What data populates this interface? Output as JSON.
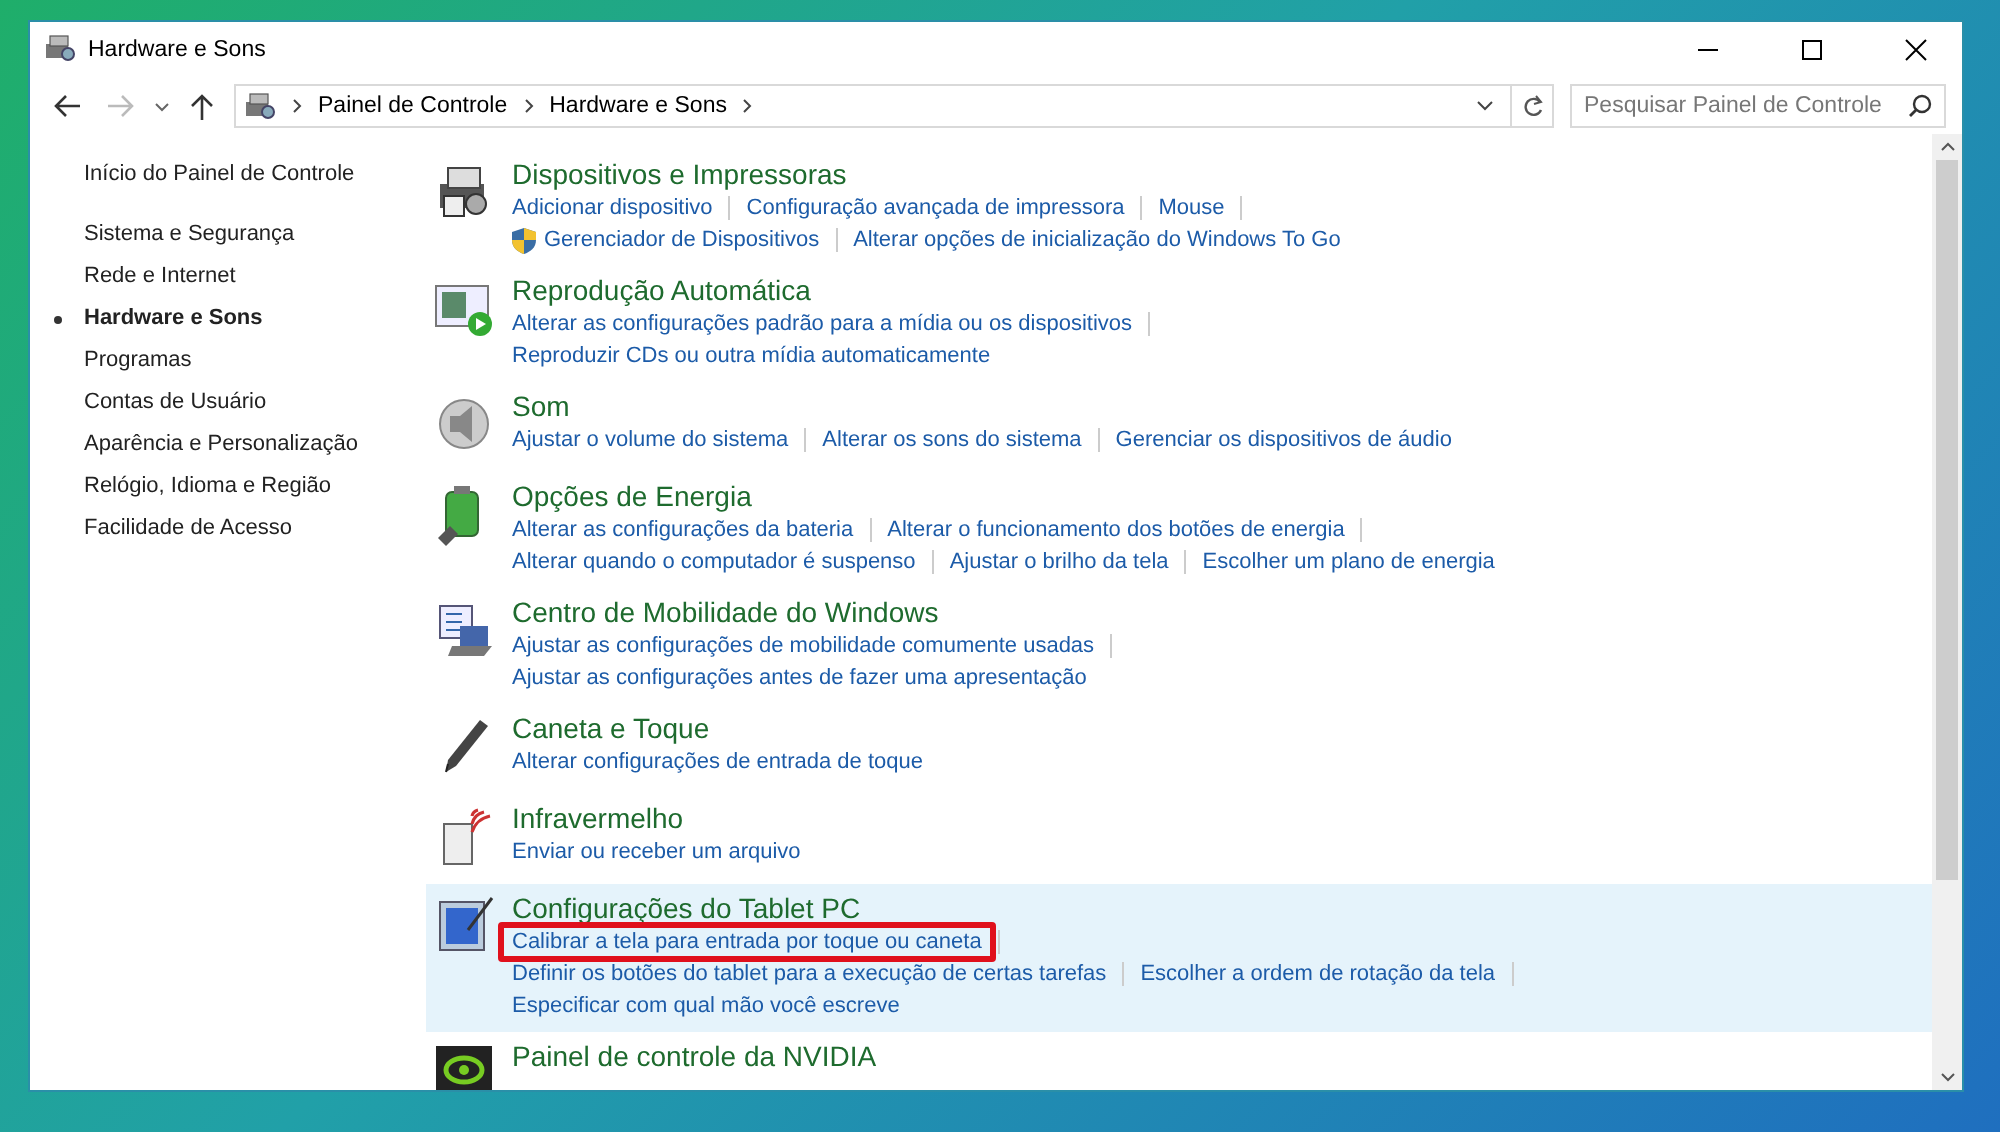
{
  "window": {
    "title": "Hardware e Sons"
  },
  "address_bar": {
    "breadcrumbs": [
      "Painel de Controle",
      "Hardware e Sons"
    ]
  },
  "search": {
    "placeholder": "Pesquisar Painel de Controle"
  },
  "sidebar": {
    "home": "Início do Painel de Controle",
    "items": [
      {
        "label": "Sistema e Segurança",
        "selected": false
      },
      {
        "label": "Rede e Internet",
        "selected": false
      },
      {
        "label": "Hardware e Sons",
        "selected": true
      },
      {
        "label": "Programas",
        "selected": false
      },
      {
        "label": "Contas de Usuário",
        "selected": false
      },
      {
        "label": "Aparência e Personalização",
        "selected": false
      },
      {
        "label": "Relógio, Idioma e Região",
        "selected": false
      },
      {
        "label": "Facilidade de Acesso",
        "selected": false
      }
    ]
  },
  "categories": [
    {
      "title": "Dispositivos e Impressoras",
      "selected": false,
      "rows": [
        [
          {
            "label": "Adicionar dispositivo"
          },
          {
            "label": "Configuração avançada de impressora"
          },
          {
            "label": "Mouse"
          }
        ],
        [
          {
            "label": "Gerenciador de Dispositivos",
            "shield": true
          },
          {
            "label": "Alterar opções de inicialização do Windows To Go"
          }
        ]
      ]
    },
    {
      "title": "Reprodução Automática",
      "selected": false,
      "rows": [
        [
          {
            "label": "Alterar as configurações padrão para a mídia ou os dispositivos"
          }
        ],
        [
          {
            "label": "Reproduzir CDs ou outra mídia automaticamente"
          }
        ]
      ]
    },
    {
      "title": "Som",
      "selected": false,
      "rows": [
        [
          {
            "label": "Ajustar o volume do sistema"
          },
          {
            "label": "Alterar os sons do sistema"
          },
          {
            "label": "Gerenciar os dispositivos de áudio"
          }
        ]
      ]
    },
    {
      "title": "Opções de Energia",
      "selected": false,
      "rows": [
        [
          {
            "label": "Alterar as configurações da bateria"
          },
          {
            "label": "Alterar o funcionamento dos botões de energia"
          }
        ],
        [
          {
            "label": "Alterar quando o computador é suspenso"
          },
          {
            "label": "Ajustar o brilho da tela"
          },
          {
            "label": "Escolher um plano de energia"
          }
        ]
      ]
    },
    {
      "title": "Centro de Mobilidade do Windows",
      "selected": false,
      "rows": [
        [
          {
            "label": "Ajustar as configurações de mobilidade comumente usadas"
          }
        ],
        [
          {
            "label": "Ajustar as configurações antes de fazer uma apresentação"
          }
        ]
      ]
    },
    {
      "title": "Caneta e Toque",
      "selected": false,
      "rows": [
        [
          {
            "label": "Alterar configurações de entrada de toque"
          }
        ]
      ]
    },
    {
      "title": "Infravermelho",
      "selected": false,
      "rows": [
        [
          {
            "label": "Enviar ou receber um arquivo"
          }
        ]
      ]
    },
    {
      "title": "Configurações do Tablet PC",
      "selected": true,
      "rows": [
        [
          {
            "label": "Calibrar a tela para entrada por toque ou caneta",
            "highlighted": true
          }
        ],
        [
          {
            "label": "Definir os botões do tablet para a execução de certas tarefas"
          },
          {
            "label": "Escolher a ordem de rotação da tela"
          }
        ],
        [
          {
            "label": "Especificar com qual mão você escreve"
          }
        ]
      ]
    },
    {
      "title": "Painel de controle da NVIDIA",
      "selected": false
    }
  ]
}
